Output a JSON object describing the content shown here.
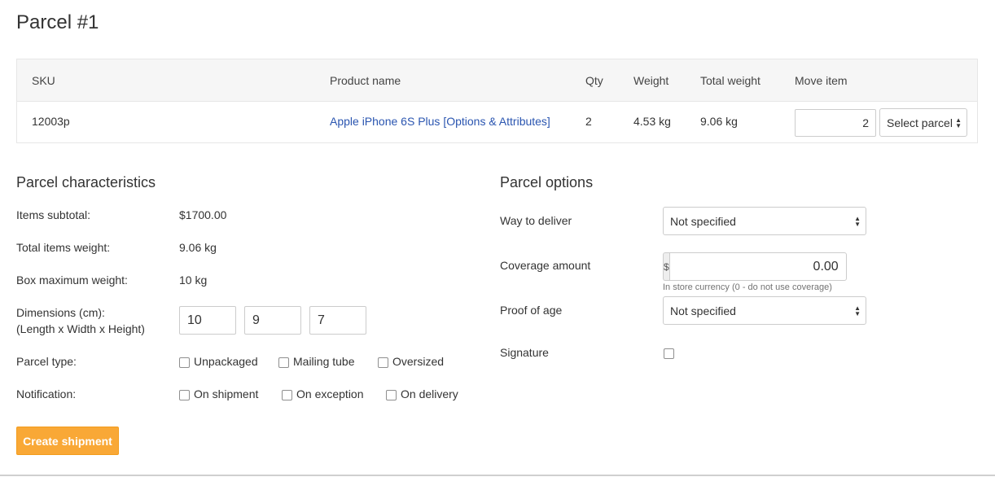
{
  "page": {
    "title": "Parcel #1"
  },
  "items_table": {
    "headers": {
      "sku": "SKU",
      "product_name": "Product name",
      "qty": "Qty",
      "weight": "Weight",
      "total_weight": "Total weight",
      "move_item": "Move item"
    },
    "rows": [
      {
        "sku": "12003p",
        "product_name": "Apple iPhone 6S Plus [Options & Attributes]",
        "qty": "2",
        "weight": "4.53 kg",
        "total_weight": "9.06 kg",
        "move_qty": "2",
        "move_select": "Select parcel"
      }
    ]
  },
  "characteristics": {
    "title": "Parcel characteristics",
    "items_subtotal_label": "Items subtotal:",
    "items_subtotal_value": "$1700.00",
    "total_weight_label": "Total items weight:",
    "total_weight_value": "9.06 kg",
    "box_max_label": "Box maximum weight:",
    "box_max_value": "10 kg",
    "dimensions_label_1": "Dimensions (cm):",
    "dimensions_label_2": "(Length x Width x Height)",
    "dimensions": {
      "length": "10",
      "width": "9",
      "height": "7"
    },
    "parcel_type_label": "Parcel type:",
    "parcel_types": [
      "Unpackaged",
      "Mailing tube",
      "Oversized"
    ],
    "notification_label": "Notification:",
    "notifications": [
      "On shipment",
      "On exception",
      "On delivery"
    ]
  },
  "options": {
    "title": "Parcel options",
    "way_label": "Way to deliver",
    "way_value": "Not specified",
    "coverage_label": "Coverage amount",
    "coverage_addon": "$",
    "coverage_value": "0.00",
    "coverage_help": "In store currency (0 - do not use coverage)",
    "proof_label": "Proof of age",
    "proof_value": "Not specified",
    "signature_label": "Signature"
  },
  "actions": {
    "create_label": "Create shipment"
  },
  "colors": {
    "accent": "#f9a836",
    "link": "#2a55b0"
  }
}
